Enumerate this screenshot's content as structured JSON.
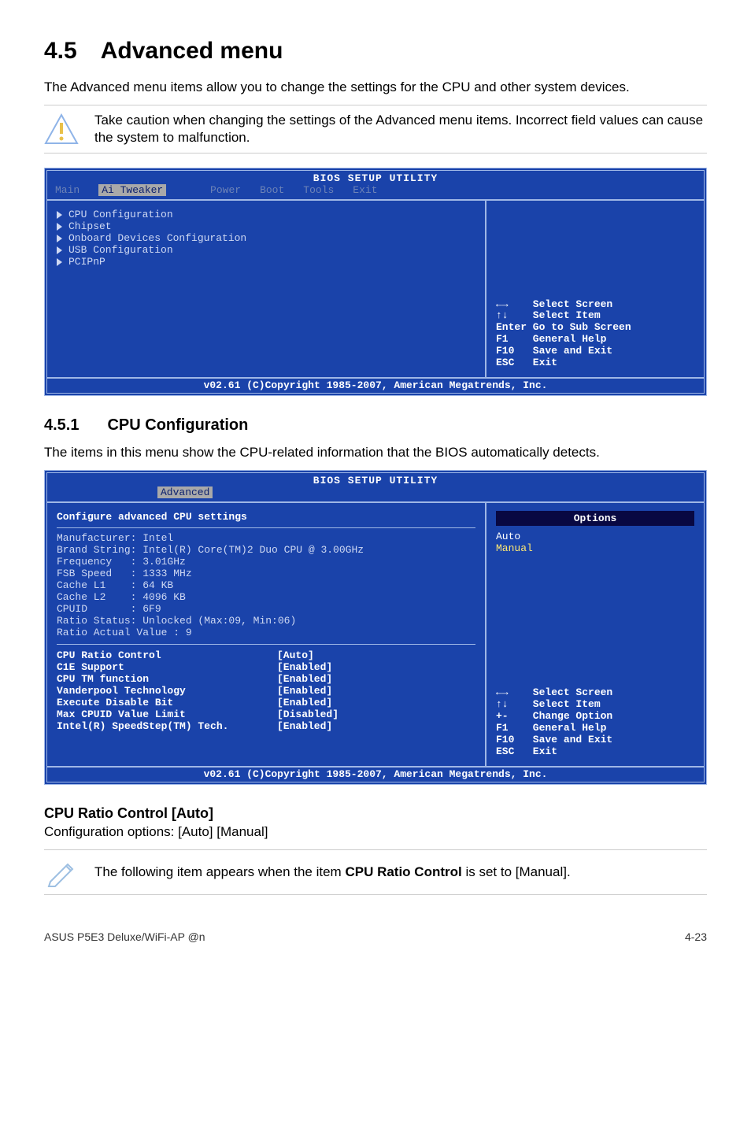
{
  "section": {
    "number": "4.5",
    "title": "Advanced menu"
  },
  "intro": "The Advanced menu items allow you to change the settings for the CPU and other system devices.",
  "caution": "Take caution when changing the settings of the Advanced menu items. Incorrect field values can cause the system to malfunction.",
  "bios1": {
    "title": "BIOS SETUP UTILITY",
    "tabs": {
      "main": "Main",
      "ai": "Ai Tweaker",
      "power": "Power",
      "boot": "Boot",
      "tools": "Tools",
      "exit": "Exit"
    },
    "items": [
      "CPU Configuration",
      "Chipset",
      "Onboard Devices Configuration",
      "USB Configuration",
      "PCIPnP"
    ],
    "keys": {
      "selscreen": "←→    Select Screen",
      "selitem": "↑↓    Select Item",
      "enter": "Enter Go to Sub Screen",
      "f1": "F1    General Help",
      "f10": "F10   Save and Exit",
      "esc": "ESC   Exit"
    },
    "copyright": "v02.61 (C)Copyright 1985-2007, American Megatrends, Inc."
  },
  "subsection": {
    "number": "4.5.1",
    "title": "CPU Configuration"
  },
  "subintro": "The items in this menu show the CPU-related information that the BIOS automatically detects.",
  "bios2": {
    "title": "BIOS SETUP UTILITY",
    "tab_label": "Advanced",
    "heading": "Configure advanced CPU settings",
    "info": {
      "mfr": "Manufacturer: Intel",
      "brand": "Brand String: Intel(R) Core(TM)2 Duo CPU @ 3.00GHz",
      "freq": "Frequency   : 3.01GHz",
      "fsb": "FSB Speed   : 1333 MHz",
      "l1": "Cache L1    : 64 KB",
      "l2": "Cache L2    : 4096 KB",
      "cpuid": "CPUID       : 6F9",
      "ratio": "Ratio Status: Unlocked (Max:09, Min:06)",
      "rav": "Ratio Actual Value : 9"
    },
    "config": [
      {
        "k": "CPU Ratio Control",
        "v": "[Auto]"
      },
      {
        "k": "C1E Support",
        "v": "[Enabled]"
      },
      {
        "k": "CPU TM function",
        "v": "[Enabled]"
      },
      {
        "k": "Vanderpool Technology",
        "v": "[Enabled]"
      },
      {
        "k": "Execute Disable Bit",
        "v": "[Enabled]"
      },
      {
        "k": "Max CPUID Value Limit",
        "v": "[Disabled]"
      },
      {
        "k": "Intel(R) SpeedStep(TM) Tech.",
        "v": "[Enabled]"
      }
    ],
    "options_title": "Options",
    "options": {
      "auto": "Auto",
      "manual": "Manual"
    },
    "keys": {
      "selscreen": "←→    Select Screen",
      "selitem": "↑↓    Select Item",
      "chg": "+-    Change Option",
      "f1": "F1    General Help",
      "f10": "F10   Save and Exit",
      "esc": "ESC   Exit"
    },
    "copyright": "v02.61 (C)Copyright 1985-2007, American Megatrends, Inc."
  },
  "heading3": "CPU Ratio Control [Auto]",
  "cfg_line": "Configuration options: [Auto] [Manual]",
  "note": {
    "pre": "The following item appears when the item ",
    "bold": "CPU Ratio Control",
    "post": " is set to [Manual]."
  },
  "footer": {
    "left": "ASUS P5E3 Deluxe/WiFi-AP @n",
    "right": "4-23"
  }
}
